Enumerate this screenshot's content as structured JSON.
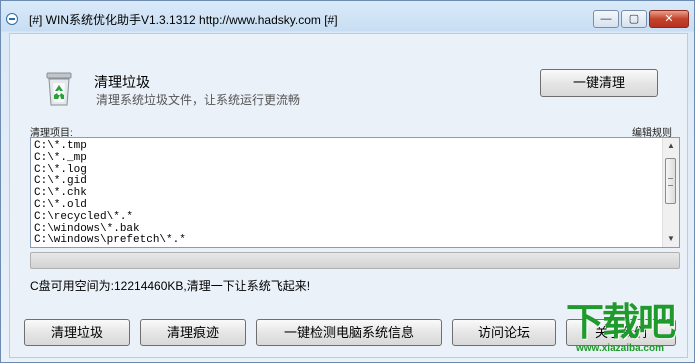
{
  "window": {
    "title": "[#] WIN系统优化助手V1.3.1312  http://www.hadsky.com [#]",
    "controls": {
      "minimize": "—",
      "maximize": "▢",
      "close": "✕"
    }
  },
  "header": {
    "icon": "recycle-bin-icon",
    "title": "清理垃圾",
    "subtitle": "清理系统垃圾文件，让系统运行更流畅",
    "onekey_clean_label": "一键清理"
  },
  "list": {
    "label": "清理项目:",
    "edit_rules_label": "编辑规则",
    "items": [
      "C:\\*.tmp",
      "C:\\*._mp",
      "C:\\*.log",
      "C:\\*.gid",
      "C:\\*.chk",
      "C:\\*.old",
      "C:\\recycled\\*.*",
      "C:\\windows\\*.bak",
      "C:\\windows\\prefetch\\*.*"
    ]
  },
  "status_text": "C盘可用空间为:12214460KB,清理一下让系统飞起来!",
  "buttons": {
    "clean_junk": "清理垃圾",
    "clean_traces": "清理痕迹",
    "detect_system": "一键检测电脑系统信息",
    "visit_forum": "访问论坛",
    "about": "关于我们"
  },
  "watermark": {
    "logo": "下载吧",
    "url": "www.xiazaiba.com"
  },
  "colors": {
    "titlebar": "#c9def3",
    "close_button": "#c4422b",
    "watermark_green": "#1f9a2c",
    "icon_green": "#2e9e3a"
  }
}
